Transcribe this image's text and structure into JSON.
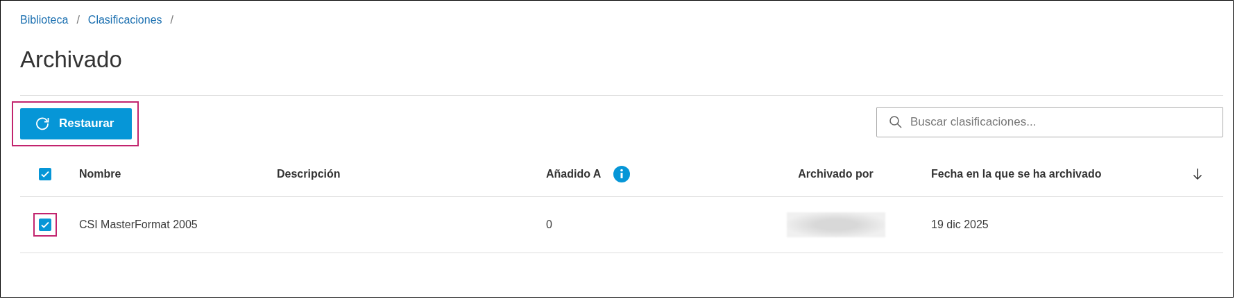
{
  "breadcrumb": [
    {
      "label": "Biblioteca",
      "separator": "/"
    },
    {
      "label": "Clasificaciones",
      "separator": "/"
    }
  ],
  "title": "Archivado",
  "toolbar": {
    "restore_button": {
      "label": "Restaurar",
      "highlighted": true
    },
    "search": {
      "placeholder": "Buscar clasificaciones..."
    }
  },
  "table": {
    "select_all": {
      "checked": true
    },
    "columns": [
      {
        "label": "Nombre",
        "kind": "text"
      },
      {
        "label": "Descripción",
        "kind": "text"
      },
      {
        "label": "Añadido A",
        "kind": "info"
      },
      {
        "label": "Archivado por",
        "kind": "center"
      },
      {
        "label": "Fecha en la que se ha archivado",
        "kind": "sorted"
      }
    ],
    "rows": [
      {
        "checked": true,
        "highlighted": true,
        "name": "CSI MasterFormat 2005",
        "added_to": "0",
        "archived_by": {
          "kind": "blurred"
        },
        "date": "19 dic 2025"
      }
    ]
  }
}
